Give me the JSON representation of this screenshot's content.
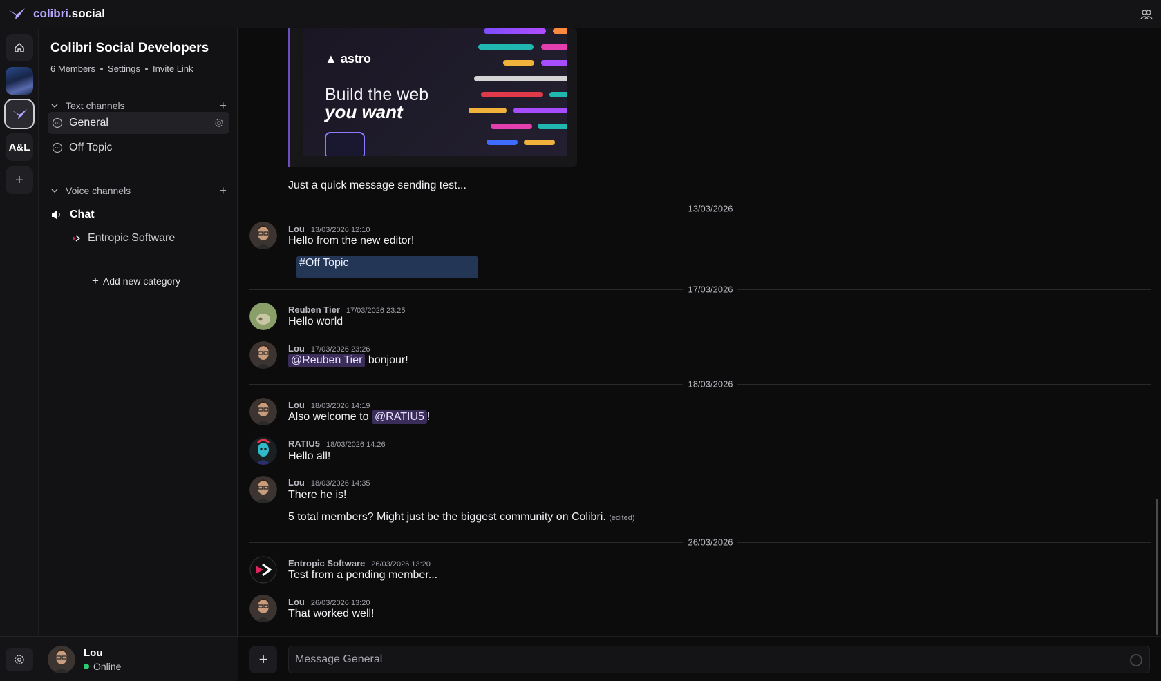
{
  "app": {
    "brand_part1": "colibri",
    "brand_part2": ".social"
  },
  "rail": {
    "server_initials": "A&L",
    "add_label": "+"
  },
  "server": {
    "name": "Colibri Social Developers",
    "members": "6 Members",
    "settings": "Settings",
    "invite": "Invite Link"
  },
  "categories": {
    "text": "Text channels",
    "voice": "Voice channels",
    "add_new": "Add new category"
  },
  "channels": {
    "general": "General",
    "off_topic": "Off Topic",
    "voice_chat": "Chat",
    "voice_member": "Entropic Software"
  },
  "user": {
    "name": "Lou",
    "status": "Online",
    "status_color": "#2ecc71"
  },
  "embed": {
    "logo": "astro",
    "headline_1": "Build the web",
    "headline_2": "you want"
  },
  "messages": {
    "m0_text": "Just a quick message sending test...",
    "d1": "13/03/2026",
    "m1_name": "Lou",
    "m1_time": "13/03/2026 12:10",
    "m1_text": "Hello from the new editor!",
    "m1_chip": "#Off Topic",
    "d2": "17/03/2026",
    "m2_name": "Reuben Tier",
    "m2_time": "17/03/2026 23:25",
    "m2_text": "Hello world",
    "m3_name": "Lou",
    "m3_time": "17/03/2026 23:26",
    "m3_mention": "@Reuben Tier",
    "m3_text": " bonjour!",
    "d3": "18/03/2026",
    "m4_name": "Lou",
    "m4_time": "18/03/2026 14:19",
    "m4_text": "Also welcome to ",
    "m4_mention": "@RATIU5",
    "m4_suffix": "!",
    "m5_name": "RATIU5",
    "m5_time": "18/03/2026 14:26",
    "m5_text": "Hello all!",
    "m6_name": "Lou",
    "m6_time": "18/03/2026 14:35",
    "m6_text": "There he is!",
    "m6b_text": "5 total members? Might just be the biggest community on Colibri.",
    "m6b_edited": "(edited)",
    "d4": "26/03/2026",
    "m7_name": "Entropic Software",
    "m7_time": "26/03/2026 13:20",
    "m7_text": "Test from a pending member...",
    "m8_name": "Lou",
    "m8_time": "26/03/2026 13:20",
    "m8_text": "That worked well!"
  },
  "composer": {
    "placeholder": "Message General"
  },
  "colors": {
    "accent": "#b9a6ff",
    "mention_bg": "#3a2d5a",
    "channel_chip_bg": "#243655"
  }
}
